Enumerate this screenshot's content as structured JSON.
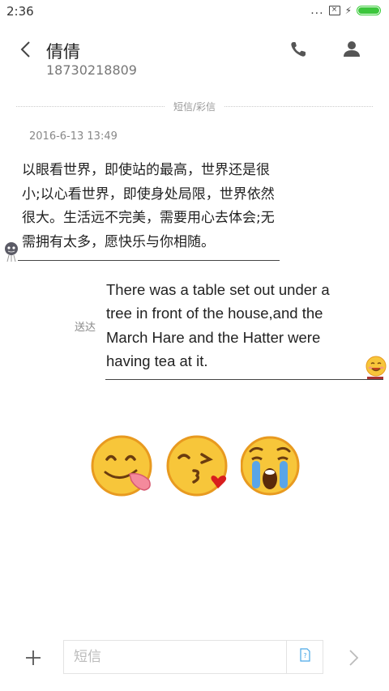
{
  "status_bar": {
    "time": "2:36",
    "more": "...",
    "battery_level": 1.0,
    "battery_color": "#3cc63c"
  },
  "header": {
    "contact_name": "倩倩",
    "phone_number": "18730218809",
    "icons": {
      "back": "chevron-left-icon",
      "call": "phone-icon",
      "contact": "person-icon"
    }
  },
  "conversation": {
    "type_label": "短信/彩信",
    "timestamp": "2016-6-13 13:49",
    "incoming": {
      "text": "以眼看世界，即使站的最高，世界还是很小;以心看世界，即使身处局限，世界依然很大。生活远不完美，需要用心去体会;无需拥有太多，愿快乐与你相随。"
    },
    "outgoing": {
      "status": "送达",
      "text": "There was a table set out under a tree in front of the house,and the March Hare and the Hatter were having tea at it."
    },
    "emojis": [
      "tongue-out-face",
      "kissing-face-with-heart",
      "crying-face"
    ]
  },
  "composer": {
    "placeholder": "短信",
    "icons": {
      "add": "plus-icon",
      "sim": "sim-card-icon",
      "send": "send-chevron-icon"
    }
  },
  "colors": {
    "accent_emoji": "#f7c63a",
    "emoji_outline": "#e89a20",
    "heart": "#d81e1e",
    "tear": "#5aa5e8"
  }
}
